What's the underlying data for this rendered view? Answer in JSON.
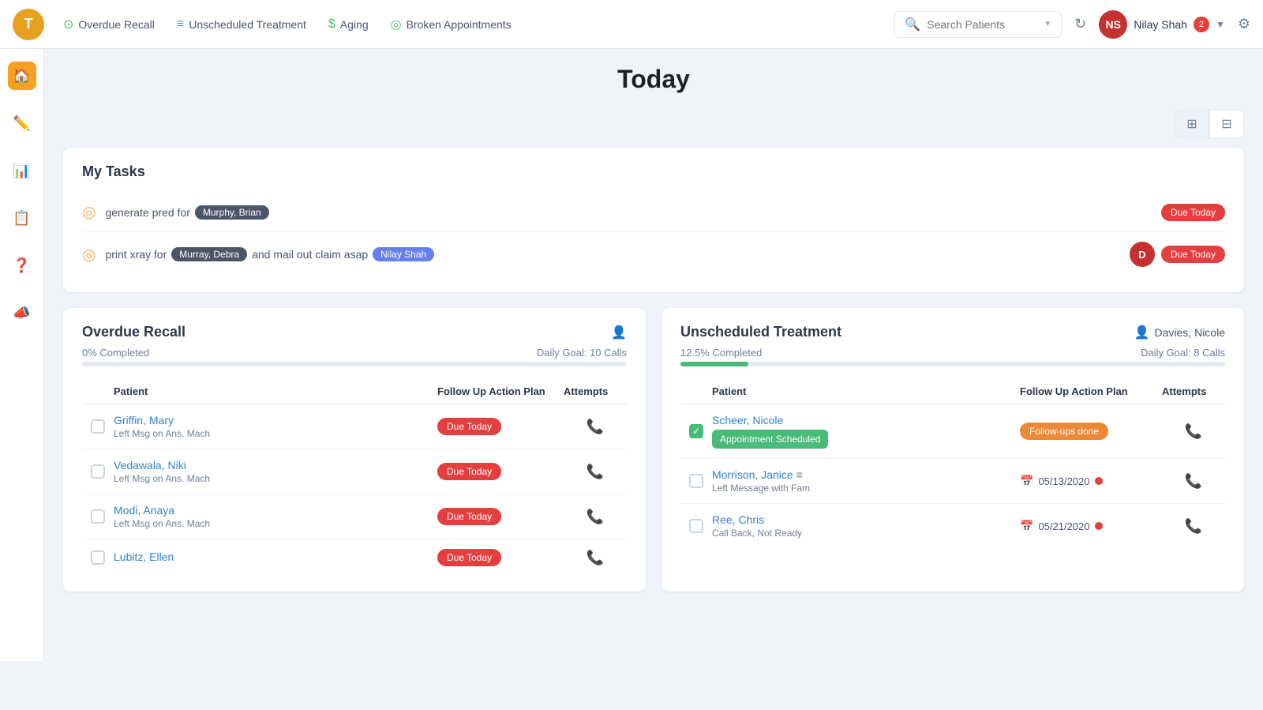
{
  "app": {
    "logo_letter": "T"
  },
  "topnav": {
    "items": [
      {
        "id": "overdue-recall",
        "label": "Overdue Recall",
        "icon": "clock"
      },
      {
        "id": "unscheduled-treatment",
        "label": "Unscheduled Treatment",
        "icon": "list"
      },
      {
        "id": "aging",
        "label": "Aging",
        "icon": "dollar"
      },
      {
        "id": "broken-appointments",
        "label": "Broken Appointments",
        "icon": "circle-check"
      }
    ],
    "search_placeholder": "Search Patients",
    "user": {
      "name": "Nilay Shah",
      "badge": "2",
      "initials": "NS"
    }
  },
  "sidebar": {
    "items": [
      {
        "id": "home",
        "icon": "🏠",
        "active": true
      },
      {
        "id": "edit",
        "icon": "✏️",
        "active": false
      },
      {
        "id": "chart",
        "icon": "📊",
        "active": false
      },
      {
        "id": "list",
        "icon": "📋",
        "active": false
      },
      {
        "id": "help",
        "icon": "❓",
        "active": false
      },
      {
        "id": "announce",
        "icon": "📣",
        "active": false
      }
    ]
  },
  "page": {
    "title": "Today"
  },
  "view_toggle": {
    "grid_label": "⊞",
    "split_label": "⊟"
  },
  "my_tasks": {
    "title": "My Tasks",
    "tasks": [
      {
        "id": "task-1",
        "prefix": "generate pred for",
        "patient_chip": "Murphy, Brian",
        "suffix": "",
        "suffix2": "",
        "due_label": "Due Today",
        "has_assignee": false
      },
      {
        "id": "task-2",
        "prefix": "print xray for",
        "patient_chip": "Murray, Debra",
        "suffix": "and mail out claim asap",
        "suffix2": "Nilay Shah",
        "due_label": "Due Today",
        "has_assignee": true,
        "assignee_initial": "D"
      }
    ]
  },
  "overdue_recall": {
    "title": "Overdue Recall",
    "completed_pct": "0% Completed",
    "progress_width": 0,
    "daily_goal": "Daily Goal: 10 Calls",
    "columns": [
      "Patient",
      "Follow Up Action Plan",
      "Attempts"
    ],
    "rows": [
      {
        "patient_name": "Griffin, Mary",
        "patient_sub": "Left Msg on Ans. Mach",
        "action": "Due Today",
        "action_type": "red"
      },
      {
        "patient_name": "Vedawala, Niki",
        "patient_sub": "Left Msg on Ans. Mach",
        "action": "Due Today",
        "action_type": "red"
      },
      {
        "patient_name": "Modi, Anaya",
        "patient_sub": "Left Msg on Ans. Mach",
        "action": "Due Today",
        "action_type": "red"
      },
      {
        "patient_name": "Lubitz, Ellen",
        "patient_sub": "",
        "action": "Due Today",
        "action_type": "red"
      }
    ]
  },
  "unscheduled_treatment": {
    "title": "Unscheduled Treatment",
    "person": "Davies, Nicole",
    "completed_pct": "12.5% Completed",
    "progress_width": 12.5,
    "daily_goal": "Daily Goal: 8 Calls",
    "columns": [
      "Patient",
      "Follow Up Action Plan",
      "Attempts"
    ],
    "rows": [
      {
        "patient_name": "Scheer, Nicole",
        "patient_sub": "Appointment Scheduled",
        "action": "Follow-ups done",
        "action_type": "yellow",
        "checked": true,
        "has_date": false,
        "sub_is_badge": true
      },
      {
        "patient_name": "Morrison, Janice",
        "patient_sub": "Left Message with Fam",
        "action": "05/13/2020",
        "action_type": "date",
        "checked": false,
        "has_date": true
      },
      {
        "patient_name": "Ree, Chris",
        "patient_sub": "Call Back, Not Ready",
        "action": "05/21/2020",
        "action_type": "date",
        "checked": false,
        "has_date": true
      }
    ]
  }
}
